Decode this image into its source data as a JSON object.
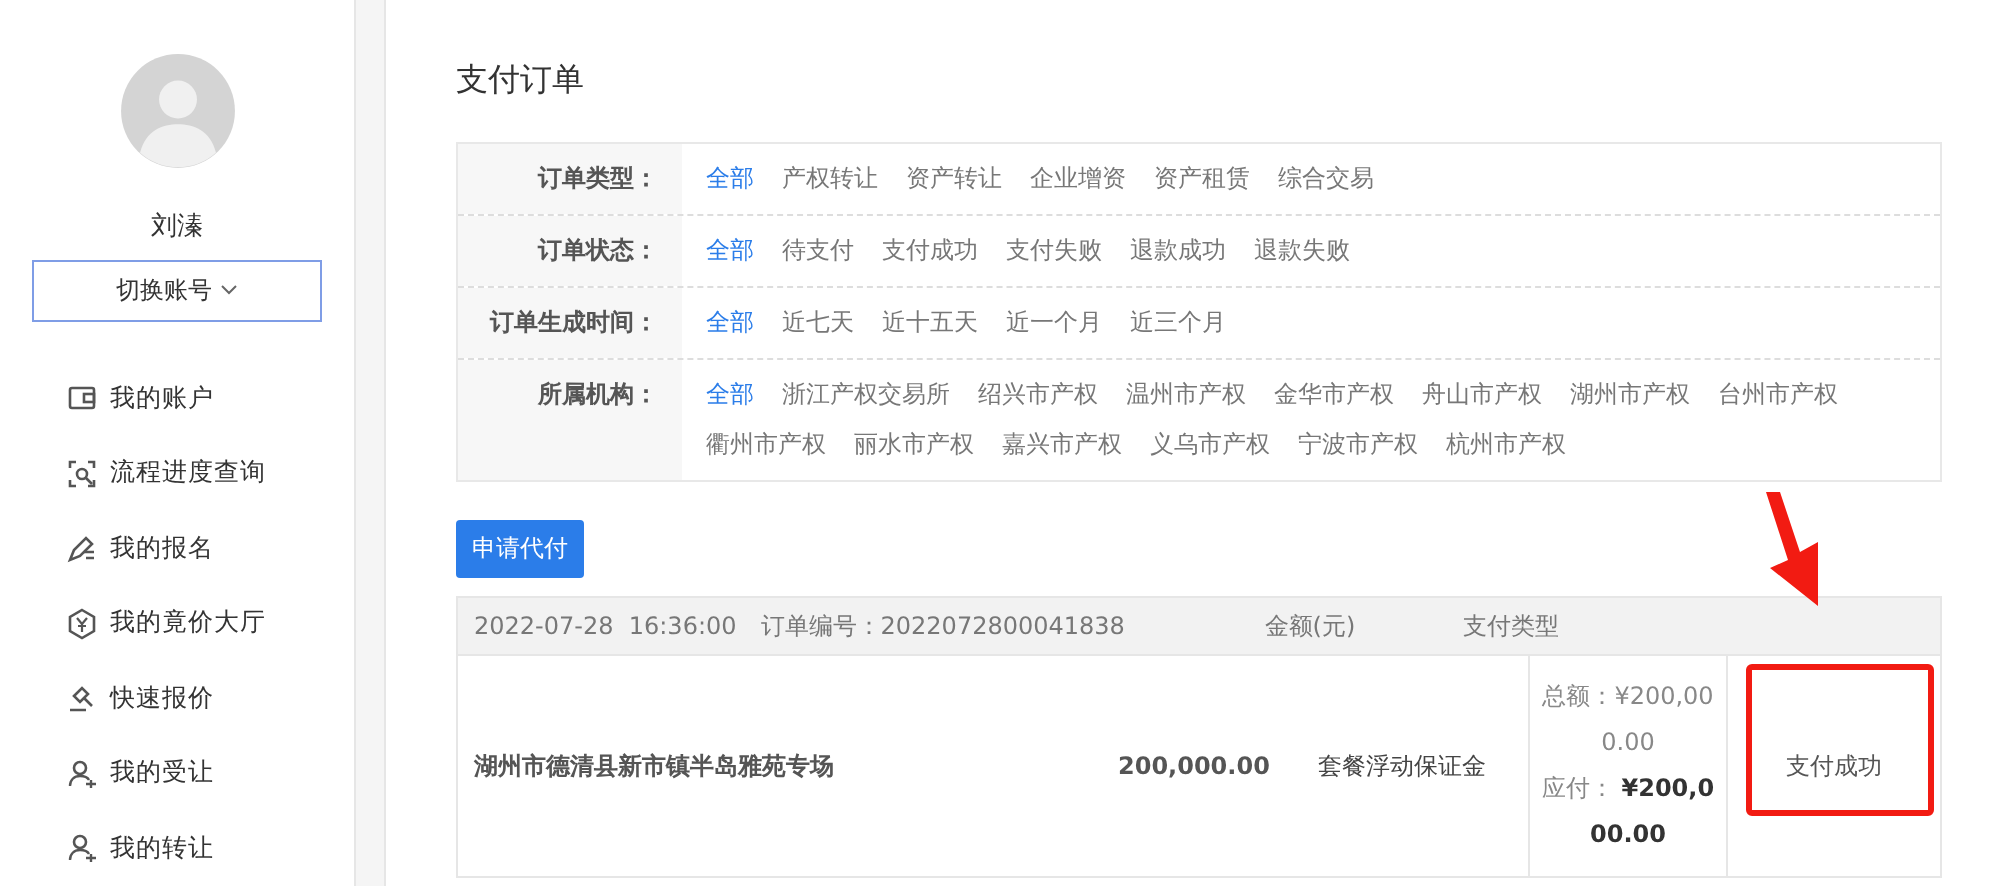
{
  "sidebar": {
    "user_name": "刘溱",
    "switch_button": "切换账号",
    "items": [
      {
        "label": "我的账户"
      },
      {
        "label": "流程进度查询"
      },
      {
        "label": "我的报名"
      },
      {
        "label": "我的竟价大厅"
      },
      {
        "label": "快速报价"
      },
      {
        "label": "我的受让"
      },
      {
        "label": "我的转让"
      }
    ]
  },
  "page_title": "支付订单",
  "filters": [
    {
      "label": "订单类型：",
      "options": [
        {
          "label": "全部",
          "selected": true
        },
        {
          "label": "产权转让",
          "selected": false
        },
        {
          "label": "资产转让",
          "selected": false
        },
        {
          "label": "企业增资",
          "selected": false
        },
        {
          "label": "资产租赁",
          "selected": false
        },
        {
          "label": "综合交易",
          "selected": false
        }
      ]
    },
    {
      "label": "订单状态：",
      "options": [
        {
          "label": "全部",
          "selected": true
        },
        {
          "label": "待支付",
          "selected": false
        },
        {
          "label": "支付成功",
          "selected": false
        },
        {
          "label": "支付失败",
          "selected": false
        },
        {
          "label": "退款成功",
          "selected": false
        },
        {
          "label": "退款失败",
          "selected": false
        }
      ]
    },
    {
      "label": "订单生成时间：",
      "options": [
        {
          "label": "全部",
          "selected": true
        },
        {
          "label": "近七天",
          "selected": false
        },
        {
          "label": "近十五天",
          "selected": false
        },
        {
          "label": "近一个月",
          "selected": false
        },
        {
          "label": "近三个月",
          "selected": false
        }
      ]
    },
    {
      "label": "所属机构：",
      "options": [
        {
          "label": "全部",
          "selected": true
        },
        {
          "label": "浙江产权交易所",
          "selected": false
        },
        {
          "label": "绍兴市产权",
          "selected": false
        },
        {
          "label": "温州市产权",
          "selected": false
        },
        {
          "label": "金华市产权",
          "selected": false
        },
        {
          "label": "舟山市产权",
          "selected": false
        },
        {
          "label": "湖州市产权",
          "selected": false
        },
        {
          "label": "台州市产权",
          "selected": false
        },
        {
          "label": "衢州市产权",
          "selected": false
        },
        {
          "label": "丽水市产权",
          "selected": false
        },
        {
          "label": "嘉兴市产权",
          "selected": false
        },
        {
          "label": "义乌市产权",
          "selected": false
        },
        {
          "label": "宁波市产权",
          "selected": false
        },
        {
          "label": "杭州市产权",
          "selected": false
        }
      ]
    }
  ],
  "apply_button": "申请代付",
  "orders": [
    {
      "datetime": "2022-07-28  16:36:00",
      "order_no": "订单编号：2022072800041838",
      "amount_header": "金额(元)",
      "type_header": "支付类型",
      "project": "湖州市德清县新市镇半岛雅苑专场",
      "amount": "200,000.00",
      "pay_type": "套餐浮动保证金",
      "total_label": "总额：",
      "total": "¥200,000.00",
      "due_label": "应付：",
      "due": "¥200,000.00",
      "status": "支付成功"
    }
  ]
}
